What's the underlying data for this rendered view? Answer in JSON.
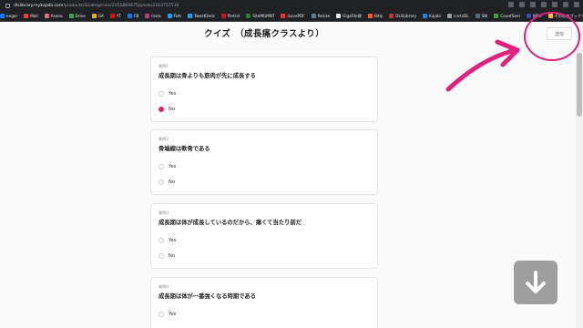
{
  "browser": {
    "url_host": "dlslibrary.mykajabi.com",
    "url_path": "/products/3/categories/2151869475/posts/2163757530",
    "bookmarks": [
      {
        "label": "enger",
        "color": "#1877f2"
      },
      {
        "label": "Mail",
        "color": "#ea4335"
      },
      {
        "label": "Asana",
        "color": "#f06a6a"
      },
      {
        "label": "Drive",
        "color": "#34a853"
      },
      {
        "label": "GA",
        "color": "#f9ab00"
      },
      {
        "label": "YT",
        "color": "#ff0000"
      },
      {
        "label": "FB",
        "color": "#1877f2"
      },
      {
        "label": "Insta",
        "color": "#c13584"
      },
      {
        "label": "Twtr",
        "color": "#1da1f2"
      },
      {
        "label": "TweetDeck",
        "color": "#1da1f2"
      },
      {
        "label": "Pintrst",
        "color": "#e60023"
      },
      {
        "label": "SiteMGMNT",
        "color": "#2e7d32"
      },
      {
        "label": "iLovePDF",
        "color": "#e53935"
      },
      {
        "label": "Resize",
        "color": "#607d8b"
      },
      {
        "label": "GigaFile便",
        "color": "#eeeeee"
      },
      {
        "label": "Bitly",
        "color": "#ee6123"
      },
      {
        "label": "DLSLibrary",
        "color": "#d32f2f"
      },
      {
        "label": "Kajabi",
        "color": "#1e88e5"
      },
      {
        "label": "cnctsDL",
        "color": "#9e9e9e"
      },
      {
        "label": "SBI",
        "color": "#546e7a"
      },
      {
        "label": "CountSeel",
        "color": "#43a047"
      },
      {
        "label": "WFG",
        "color": "#3949ab"
      },
      {
        "label": "その他のブックマーク",
        "color": "#fbc02d"
      }
    ]
  },
  "page": {
    "title": "クイズ　（成長痛クラスより）",
    "send_label": "送信"
  },
  "questions": [
    {
      "number": "質問1",
      "text": "成長期は骨よりも筋肉が先に成長する",
      "options": [
        "Yes",
        "No"
      ],
      "selected": 1
    },
    {
      "number": "質問2",
      "text": "骨端線は軟骨である",
      "options": [
        "Yes",
        "No"
      ],
      "selected": -1
    },
    {
      "number": "質問3",
      "text": "成長期は体が成長しているのだから、痛くて当たり前だ",
      "options": [
        "Yes",
        "No"
      ],
      "selected": -1
    },
    {
      "number": "質問4",
      "text": "成長期は体が一番強くなる時期である",
      "options": [
        "Yes"
      ],
      "selected": -1
    }
  ],
  "overlay": {
    "annotation_color": "#e0217f",
    "download_icon": "arrow-down-icon",
    "download_color": "#9e9e9e"
  }
}
